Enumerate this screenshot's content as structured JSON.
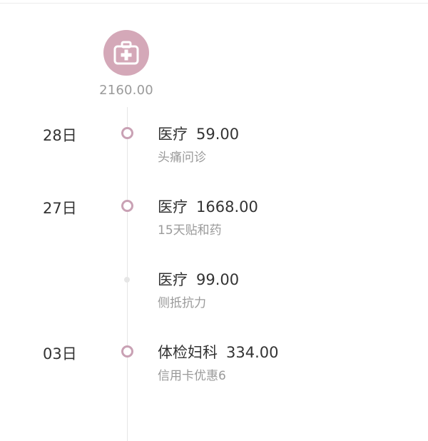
{
  "summary": {
    "icon": "medical-kit-icon",
    "total": "2160.00",
    "accent_color": "#d4a8b8"
  },
  "entries": [
    {
      "date": "28日",
      "category": "医疗",
      "amount": "59.00",
      "note": "头痛问诊",
      "node": "major"
    },
    {
      "date": "27日",
      "category": "医疗",
      "amount": "1668.00",
      "note": "15天贴和药",
      "node": "major"
    },
    {
      "date": "",
      "category": "医疗",
      "amount": "99.00",
      "note": "侧抵抗力",
      "node": "minor"
    },
    {
      "date": "03日",
      "category": "体检妇科",
      "amount": "334.00",
      "note": "信用卡优惠6",
      "node": "major"
    }
  ]
}
